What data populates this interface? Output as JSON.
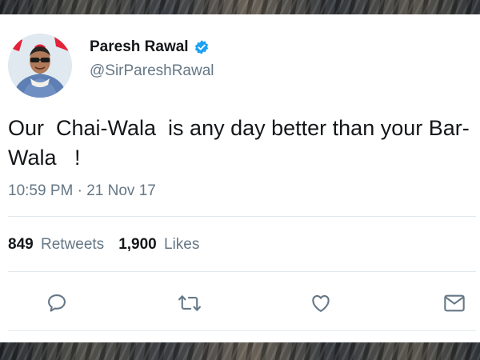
{
  "tweet": {
    "author": {
      "name": "Paresh Rawal",
      "handle": "@SirPareshRawal",
      "verified": true
    },
    "text": "Our  Chai-Wala  is any day better than your Bar-Wala   !",
    "time": "10:59 PM",
    "separator": "·",
    "date": "21 Nov 17",
    "stats": {
      "retweets_count": "849",
      "retweets_label": "Retweets",
      "likes_count": "1,900",
      "likes_label": "Likes"
    },
    "actions": [
      "reply-icon",
      "retweet-icon",
      "like-icon",
      "direct-message-icon"
    ]
  },
  "colors": {
    "text_primary": "#14171a",
    "text_secondary": "#657786",
    "verified_blue": "#1da1f2",
    "divider": "#e1e8ed"
  }
}
